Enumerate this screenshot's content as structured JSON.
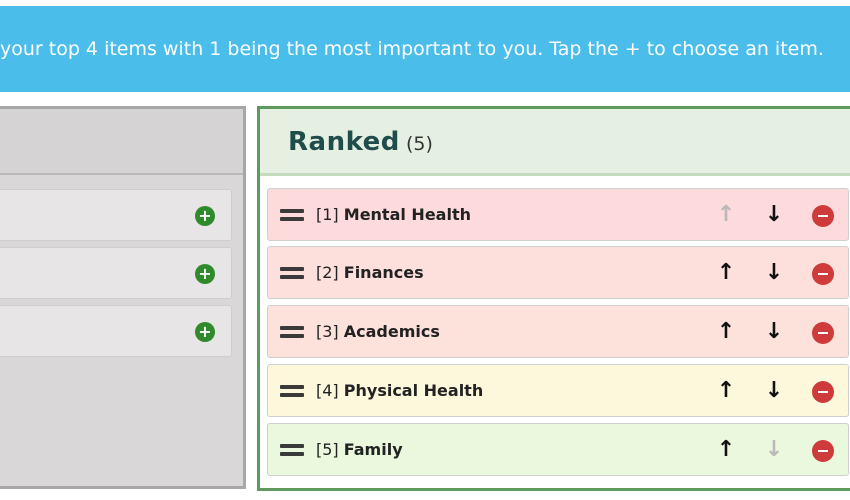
{
  "banner": {
    "text": "your top 4 items with 1 being the most important to you. Tap the + to choose an item.",
    "color": "#4bbdeb"
  },
  "available": {
    "items": [
      {
        "add_icon": "plus-circle-icon"
      },
      {
        "add_icon": "plus-circle-icon"
      },
      {
        "add_icon": "plus-circle-icon"
      }
    ]
  },
  "ranked": {
    "title": "Ranked",
    "count": "(5)",
    "items": [
      {
        "rank": "[1]",
        "name": "Mental Health",
        "bg": "#fddadc",
        "up_disabled": true,
        "down_disabled": false
      },
      {
        "rank": "[2]",
        "name": "Finances",
        "bg": "#fde0dc",
        "up_disabled": false,
        "down_disabled": false
      },
      {
        "rank": "[3]",
        "name": "Academics",
        "bg": "#fde2dc",
        "up_disabled": false,
        "down_disabled": false
      },
      {
        "rank": "[4]",
        "name": "Physical Health",
        "bg": "#fdf8dc",
        "up_disabled": false,
        "down_disabled": false
      },
      {
        "rank": "[5]",
        "name": "Family",
        "bg": "#eaf8de",
        "up_disabled": false,
        "down_disabled": true
      }
    ]
  },
  "icons": {
    "up": "↑",
    "down": "↓",
    "plus": "+"
  }
}
